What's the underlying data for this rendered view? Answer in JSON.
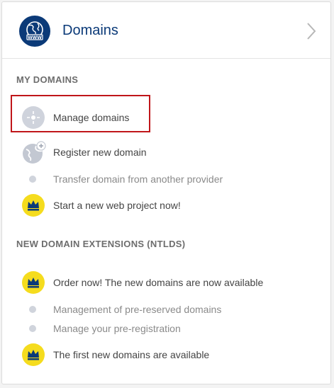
{
  "header": {
    "title": "Domains"
  },
  "sections": [
    {
      "heading": "MY DOMAINS",
      "items": [
        {
          "label": "Manage domains",
          "icon": "manage-globe-icon",
          "muted": false
        },
        {
          "label": "Register new domain",
          "icon": "globe-plus-icon",
          "muted": false
        },
        {
          "label": "Transfer domain from another provider",
          "icon": "dot-icon",
          "muted": true
        },
        {
          "label": "Start a new web project now!",
          "icon": "crown-icon",
          "muted": false
        }
      ]
    },
    {
      "heading": "NEW DOMAIN EXTENSIONS (NTLDS)",
      "items": [
        {
          "label": "Order now! The new domains are now available",
          "icon": "crown-icon",
          "muted": false
        },
        {
          "label": "Management of pre-reserved domains",
          "icon": "dot-icon",
          "muted": true
        },
        {
          "label": "Manage your pre-registration",
          "icon": "dot-icon",
          "muted": true
        },
        {
          "label": "The first new domains are available",
          "icon": "crown-icon",
          "muted": false
        }
      ]
    }
  ],
  "colors": {
    "brand": "#0b3a78",
    "crown_badge": "#f5dc1e",
    "highlight": "#c0161a"
  }
}
